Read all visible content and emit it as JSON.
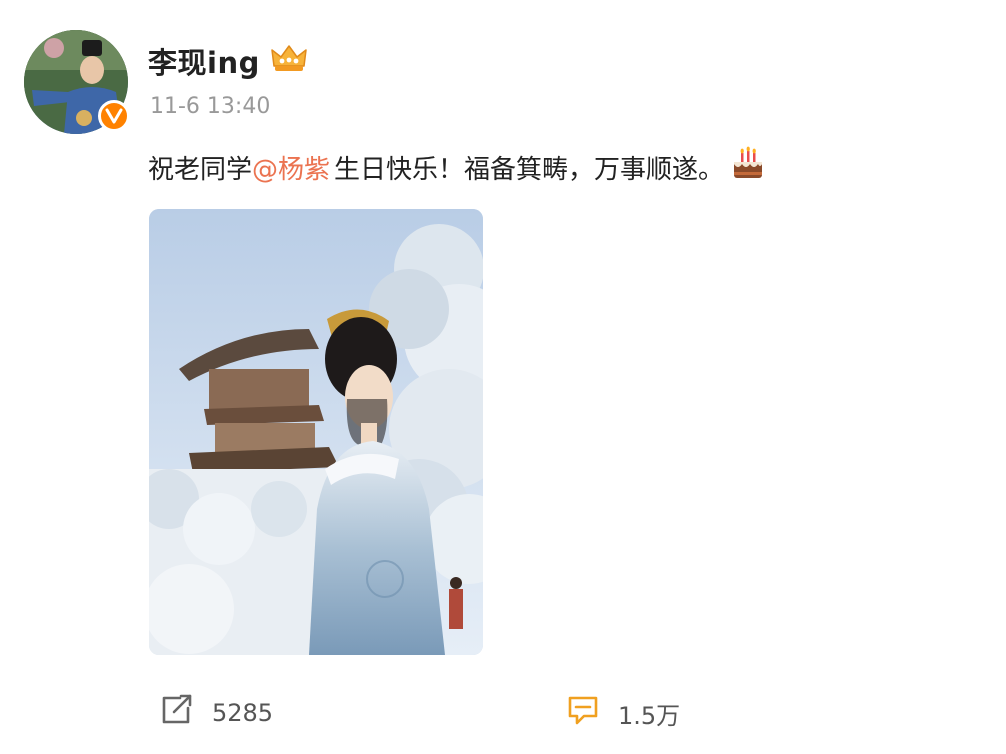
{
  "post": {
    "author": {
      "name": "李现ing",
      "avatar_icon": "avatar-portrait",
      "verified_icon": "verified-v-icon",
      "crown_icon": "vip-crown-icon"
    },
    "timestamp": "11-6 13:40",
    "text": {
      "before": "祝老同学",
      "mention": "@杨紫",
      "after": " 生日快乐！福备箕畴，万事顺遂。",
      "emoji": "cake-icon"
    },
    "image": {
      "description_icon": "photo-woman-in-hanfu"
    },
    "actions": {
      "forward_count": "5285",
      "comment_count": "1.5万"
    }
  },
  "colors": {
    "mention": "#eb7350",
    "verified_badge": "#ff8200",
    "timestamp": "#999999",
    "comment_icon": "#f0a020"
  }
}
